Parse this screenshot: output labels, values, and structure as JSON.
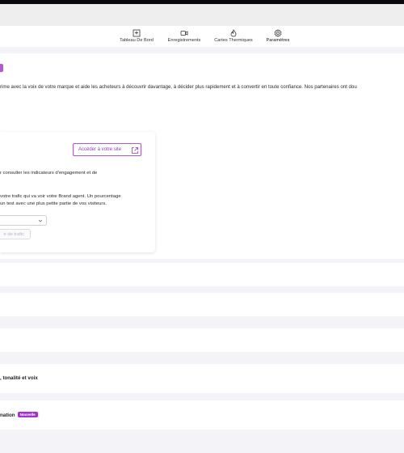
{
  "nav": {
    "tabs": [
      {
        "label": "Tableau De Bord",
        "icon": "dashboard-icon"
      },
      {
        "label": "Enregistrements",
        "icon": "video-icon"
      },
      {
        "label": "Cartes Thermiques",
        "icon": "flame-icon"
      },
      {
        "label": "Paramètres",
        "icon": "gear-icon",
        "active": true
      }
    ]
  },
  "main": {
    "description": "rime avec la voix de votre marque et aide les acheteurs à découvrir davantage, à décider plus rapidement et à convertir en toute confiance. Nos partenaires ont dou",
    "visit_button": "Accéder à votre site",
    "engagement_text": "r consulter les indicateurs d'engagement et de",
    "traffic_text_1": "votre trafic qui va voir votre Brand agent. Un pourcentage",
    "traffic_text_2": "un test avec une plus petite partie de vos visiteurs.",
    "traffic_button": "e de trafic",
    "accent_color": "#a133c9"
  },
  "sections": {
    "tone_label": ", tonalité et voix",
    "formation_label": "nation",
    "new_badge": "Nouvelle"
  }
}
